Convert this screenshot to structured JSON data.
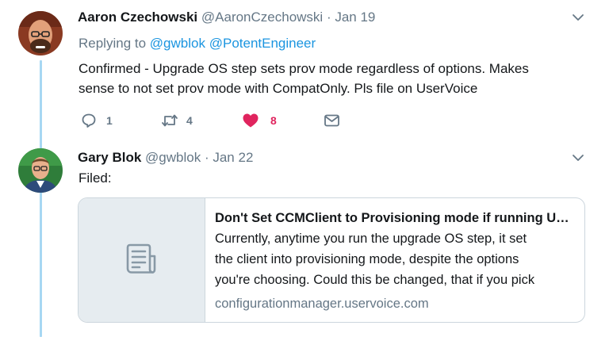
{
  "tweets": [
    {
      "name": "Aaron Czechowski",
      "handle": "@AaronCzechowski",
      "date": "· Jan 19",
      "replying_to_label": "Replying to",
      "replying_to": [
        "@gwblok",
        "@PotentEngineer"
      ],
      "text_lines": [
        "Confirmed - Upgrade OS step sets prov mode regardless of options. Makes",
        "sense to not set prov mode with CompatOnly. Pls file on UserVoice"
      ],
      "actions": {
        "reply_count": "1",
        "retweet_count": "4",
        "like_count": "8"
      },
      "like_color": "#e0245e"
    },
    {
      "name": "Gary Blok",
      "handle": "@gwblok",
      "date": "· Jan 22",
      "text": "Filed:",
      "card": {
        "title": "Don't Set CCMClient to Provisioning mode if running Upgrade OS step",
        "description_lines": [
          "Currently, anytime you run the upgrade OS step, it set",
          "the client into provisioning mode, despite the options",
          "you're choosing. Could this be changed, that if you pick"
        ],
        "domain": "configurationmanager.uservoice.com",
        "thumbnail_icon": "document-icon"
      }
    }
  ],
  "colors": {
    "accent": "#1b95e0",
    "thread_line": "#a7d7f3",
    "muted": "#657786"
  }
}
